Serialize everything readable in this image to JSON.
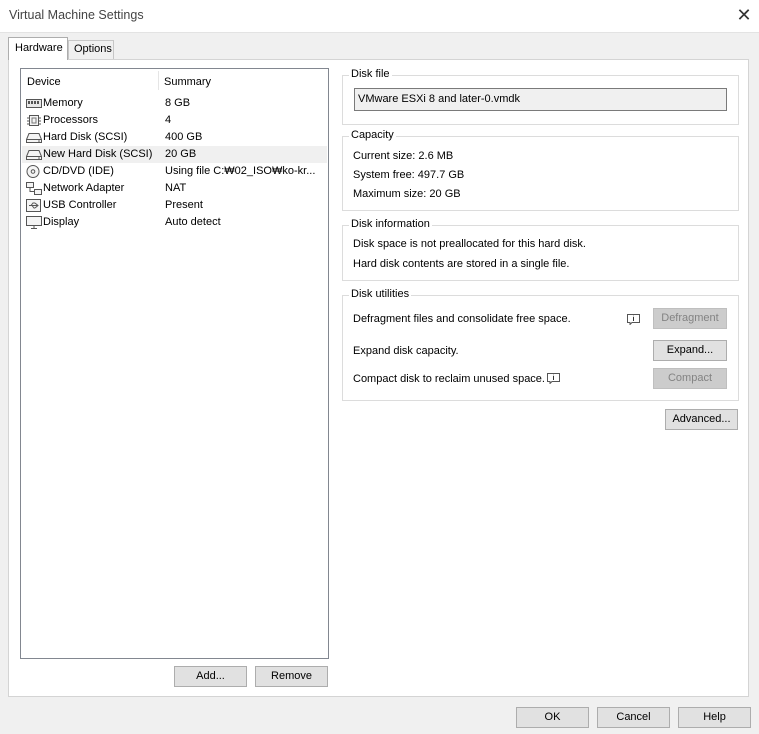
{
  "window": {
    "title": "Virtual Machine Settings"
  },
  "tabs": [
    {
      "label": "Hardware"
    },
    {
      "label": "Options"
    }
  ],
  "device_list": {
    "columns": {
      "device": "Device",
      "summary": "Summary"
    },
    "rows": [
      {
        "device": "Memory",
        "summary": "8 GB",
        "icon": "memory-icon"
      },
      {
        "device": "Processors",
        "summary": "4",
        "icon": "processor-icon"
      },
      {
        "device": "Hard Disk (SCSI)",
        "summary": "400 GB",
        "icon": "hard-disk-icon"
      },
      {
        "device": "New Hard Disk (SCSI)",
        "summary": "20 GB",
        "icon": "hard-disk-icon",
        "selected": true
      },
      {
        "device": "CD/DVD (IDE)",
        "summary": "Using file C:₩02_ISO₩ko-kr...",
        "icon": "cd-dvd-icon"
      },
      {
        "device": "Network Adapter",
        "summary": "NAT",
        "icon": "network-adapter-icon"
      },
      {
        "device": "USB Controller",
        "summary": "Present",
        "icon": "usb-icon"
      },
      {
        "device": "Display",
        "summary": "Auto detect",
        "icon": "display-icon"
      }
    ],
    "add_label": "Add...",
    "remove_label": "Remove"
  },
  "disk_file": {
    "title": "Disk file",
    "value": "VMware ESXi 8 and later-0.vmdk"
  },
  "capacity": {
    "title": "Capacity",
    "current": "Current size:  2.6 MB",
    "free": "System free:  497.7 GB",
    "max": "Maximum size:  20 GB"
  },
  "disk_information": {
    "title": "Disk information",
    "line1": "Disk space is not preallocated for this hard disk.",
    "line2": "Hard disk contents are stored in a single file."
  },
  "disk_utilities": {
    "title": "Disk utilities",
    "defrag_text": "Defragment files and consolidate free space.",
    "defrag_label": "Defragment",
    "expand_text": "Expand disk capacity.",
    "expand_label": "Expand...",
    "compact_text": "Compact disk to reclaim unused space.",
    "compact_label": "Compact"
  },
  "advanced_label": "Advanced...",
  "footer": {
    "ok": "OK",
    "cancel": "Cancel",
    "help": "Help"
  },
  "colors": {
    "selected_row": "#f0f0f0",
    "button_bg": "#e1e1e1",
    "disabled_text": "#838383"
  }
}
